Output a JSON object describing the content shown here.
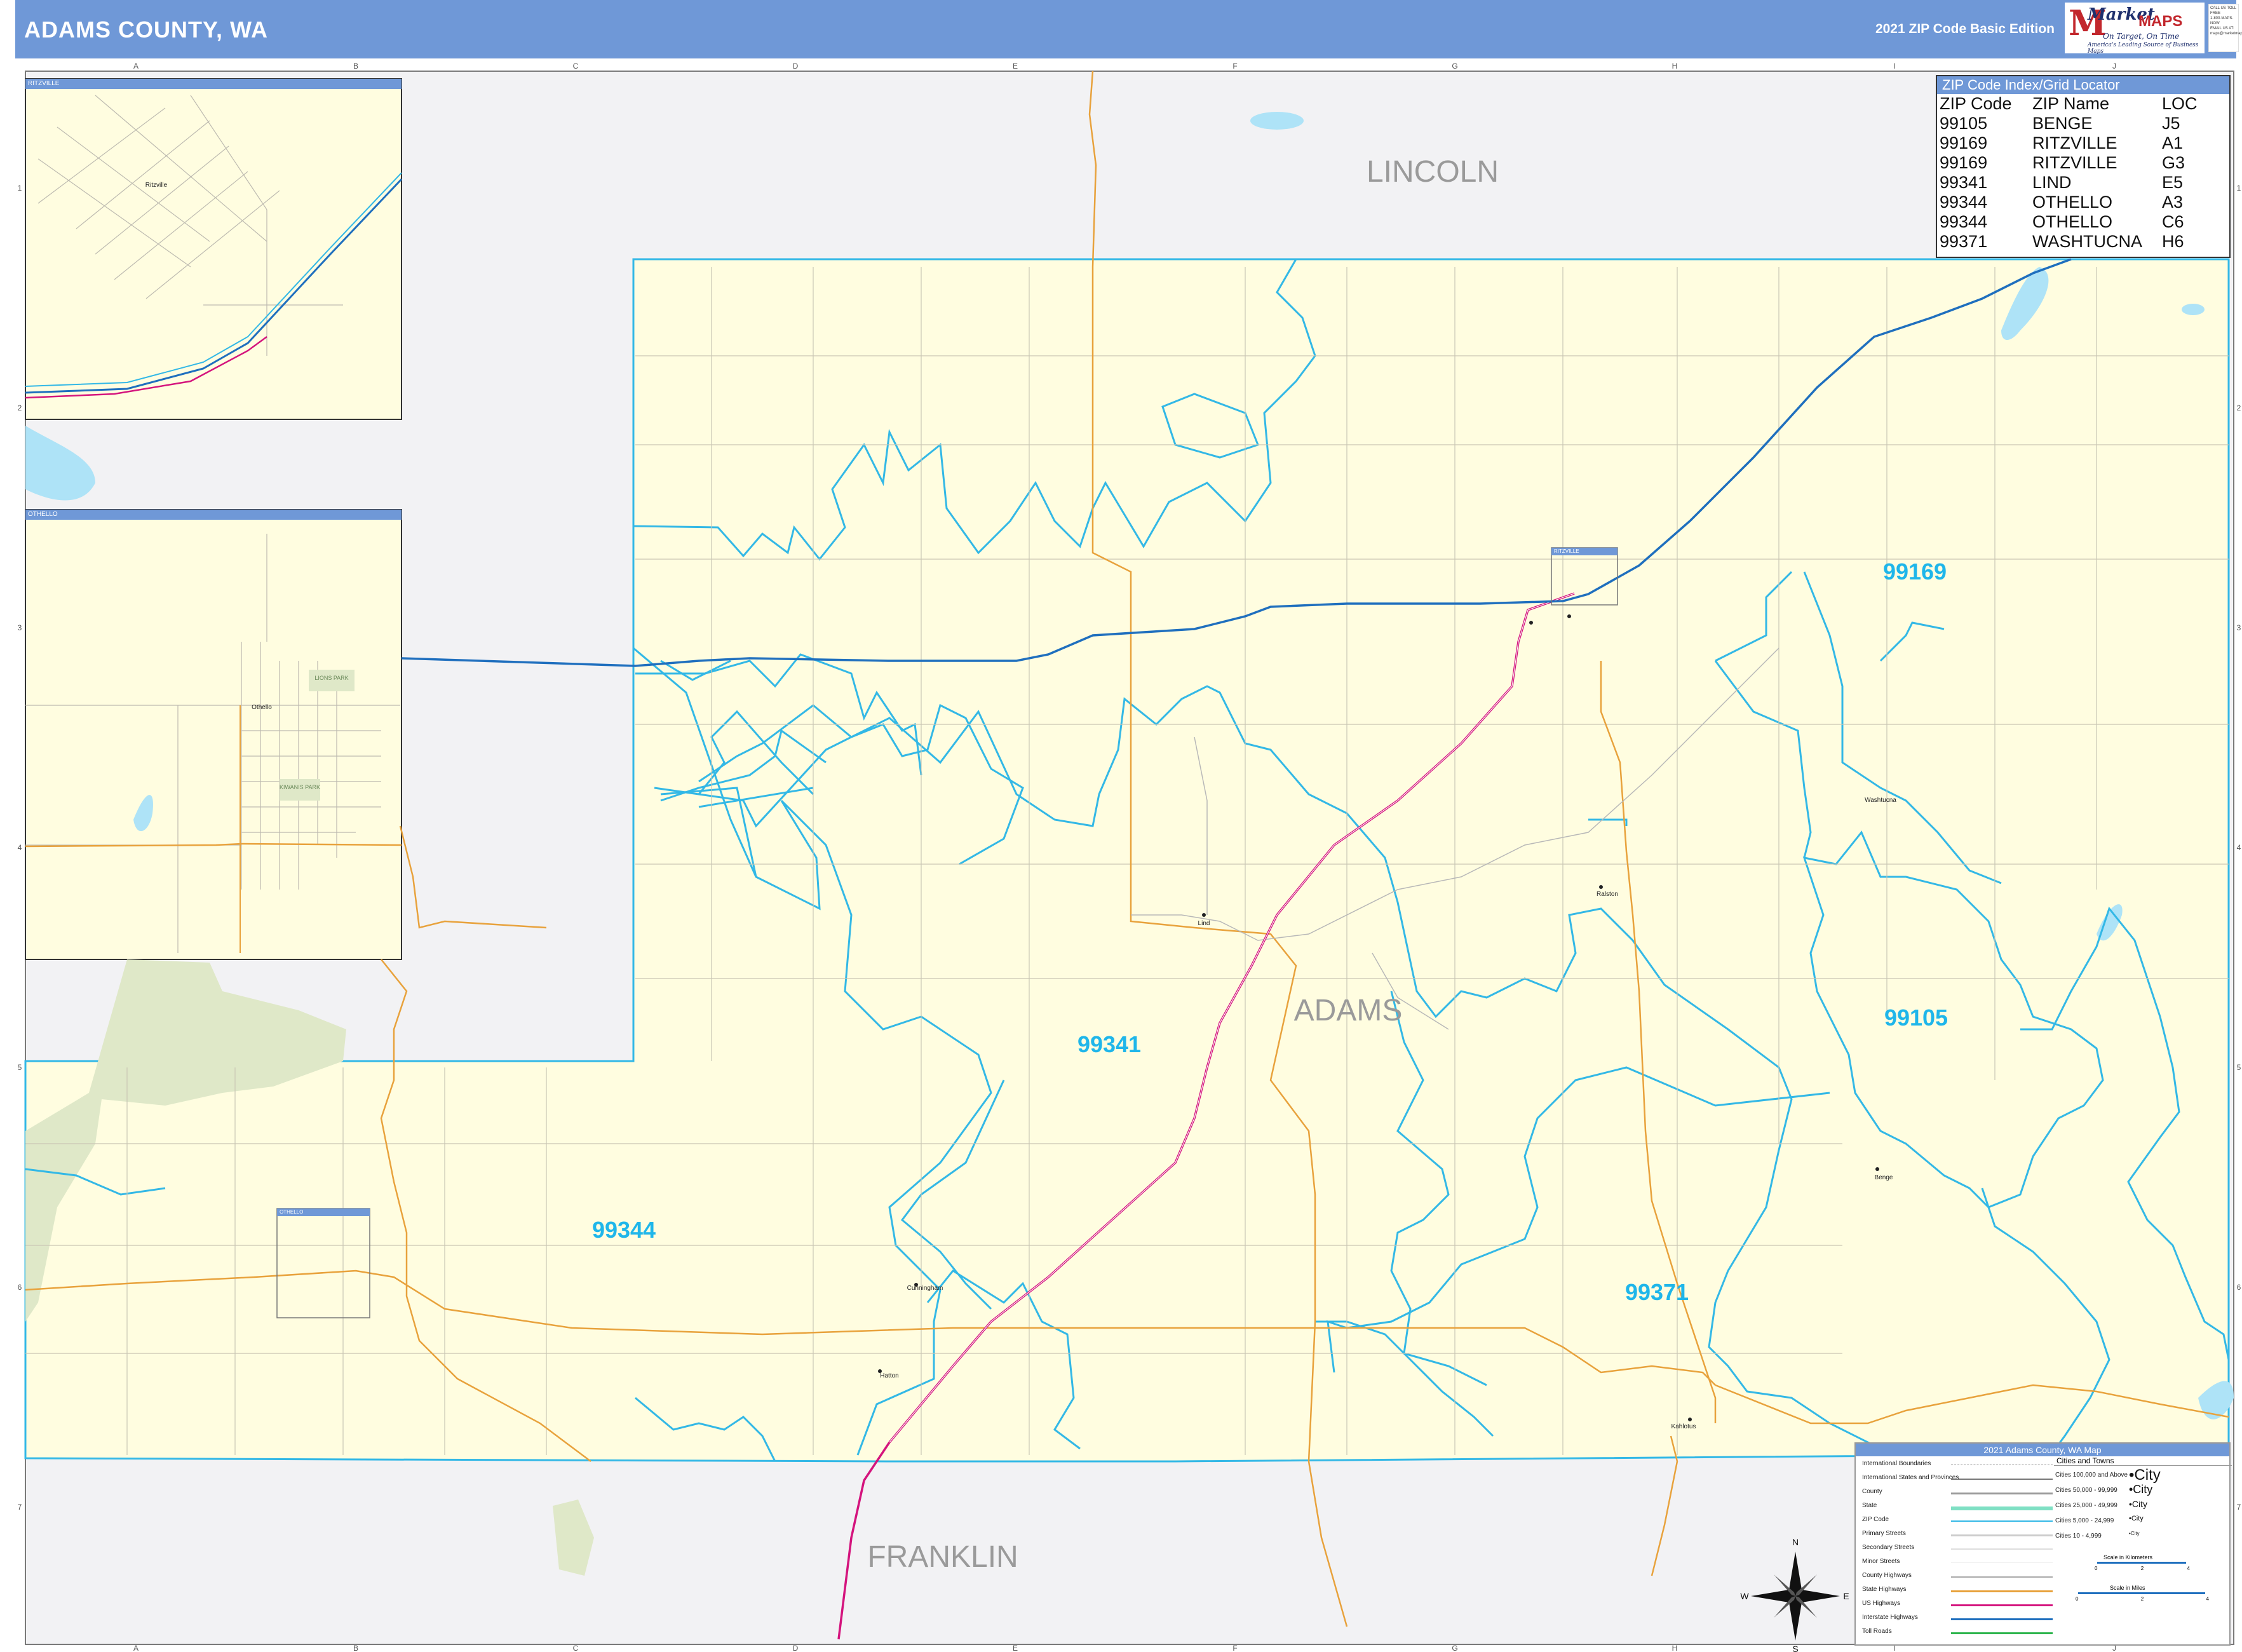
{
  "header": {
    "title": "ADAMS COUNTY, WA",
    "edition": "2021 ZIP Code Basic Edition"
  },
  "logo": {
    "brand_part1": "Market",
    "brand_part2": "MAPS",
    "tagline": "On Target, On Time",
    "subtagline": "America's Leading Source of Business Maps"
  },
  "contact": {
    "line1": "CALL US TOLL FREE",
    "line2": "1-800-MAPS-NOW",
    "line3": "EMAIL US AT:",
    "line4": "maps@marketmaps.com"
  },
  "grid": {
    "columns": [
      "A",
      "B",
      "C",
      "D",
      "E",
      "F",
      "G",
      "H",
      "I",
      "J"
    ],
    "rows": [
      "1",
      "2",
      "3",
      "4",
      "5",
      "6",
      "7"
    ]
  },
  "zip_index": {
    "title": "ZIP Code Index/Grid Locator",
    "headers": [
      "ZIP Code",
      "ZIP Name",
      "LOC"
    ],
    "rows": [
      [
        "99105",
        "BENGE",
        "J5"
      ],
      [
        "99169",
        "RITZVILLE",
        "A1"
      ],
      [
        "99169",
        "RITZVILLE",
        "G3"
      ],
      [
        "99341",
        "LIND",
        "E5"
      ],
      [
        "99344",
        "OTHELLO",
        "A3"
      ],
      [
        "99344",
        "OTHELLO",
        "C6"
      ],
      [
        "99371",
        "WASHTUCNA",
        "H6"
      ]
    ]
  },
  "map": {
    "county_names": [
      "LINCOLN",
      "ADAMS",
      "FRANKLIN"
    ],
    "zip_labels": [
      "99169",
      "99341",
      "99105",
      "99344",
      "99371"
    ],
    "inset_labels": [
      "RITZVILLE",
      "OTHELLO"
    ],
    "map_boxes": [
      "RITZVILLE",
      "OTHELLO"
    ],
    "place_labels": [
      "Ritzville",
      "Othello",
      "Lind",
      "Benge",
      "Washtucna",
      "Hatton",
      "Cunningham",
      "Ralston",
      "Kahlotus"
    ],
    "inset_places": [
      "Ritzville",
      "Othello",
      "LIONS PARK",
      "KIWANIS PARK"
    ],
    "colors": {
      "county_fill": "#fffde0",
      "outside_fill": "#f2f2f4",
      "zip_boundary": "#33b8e6",
      "interstate": "#1f6fbe",
      "us_highway": "#d4147d",
      "state_highway": "#e8a23c",
      "water": "#aee3f7",
      "park": "#dfe8c8",
      "header": "#6f98d7"
    }
  },
  "legend": {
    "title": "2021 Adams County, WA Map",
    "items": [
      "International Boundaries",
      "International States and Provinces",
      "County",
      "State",
      "ZIP Code",
      "Primary Streets",
      "Secondary Streets",
      "Minor Streets",
      "County Highways",
      "State Highways",
      "US Highways",
      "Interstate Highways",
      "Toll Roads"
    ],
    "cities_header": "Cities and Towns",
    "city_sizes": [
      "Cities 100,000 and Above",
      "Cities 50,000 - 99,999",
      "Cities 25,000 - 49,999",
      "Cities 5,000 - 24,999",
      "Cities 10 - 4,999"
    ],
    "city_samples": [
      "City",
      "City",
      "City",
      "City",
      "City"
    ],
    "scale_km": "Scale in Kilometers",
    "scale_mi": "Scale in Miles",
    "scale_ticks": [
      "0",
      "2",
      "4"
    ],
    "compass": [
      "N",
      "S",
      "E",
      "W"
    ]
  }
}
